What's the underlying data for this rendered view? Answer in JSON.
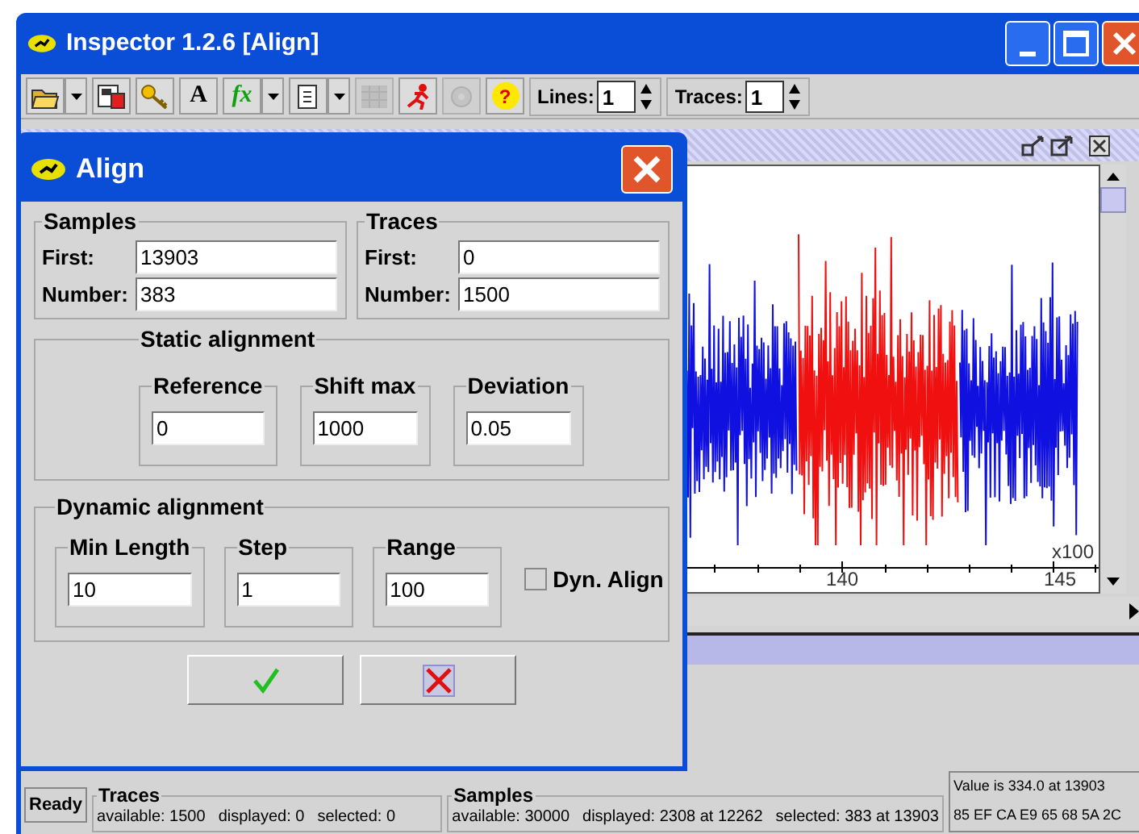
{
  "window": {
    "title": "Inspector 1.2.6 [Align]"
  },
  "toolbar": {
    "buttons": [
      {
        "kind": "open",
        "dropdown": true,
        "disabled": false
      },
      {
        "kind": "save",
        "dropdown": false,
        "disabled": false
      },
      {
        "kind": "key",
        "dropdown": false,
        "disabled": false
      },
      {
        "kind": "text",
        "text": "A",
        "dropdown": false,
        "disabled": false
      },
      {
        "kind": "formula",
        "text": "fx",
        "dropdown": true,
        "disabled": false
      },
      {
        "kind": "page",
        "dropdown": true,
        "disabled": false
      },
      {
        "kind": "grid",
        "dropdown": false,
        "disabled": true
      },
      {
        "kind": "run",
        "dropdown": false,
        "disabled": false
      },
      {
        "kind": "gear",
        "dropdown": false,
        "disabled": true
      },
      {
        "kind": "help",
        "text": "?",
        "dropdown": false,
        "disabled": false
      }
    ],
    "spinners": [
      {
        "label": "Lines:",
        "value": "1"
      },
      {
        "label": "Traces:",
        "value": "1"
      }
    ]
  },
  "plot": {
    "tick_labels": [
      "140",
      "145"
    ],
    "scale_label": "x100"
  },
  "dialog": {
    "title": "Align",
    "samples": {
      "title": "Samples",
      "fields": [
        {
          "label": "First:",
          "value": "13903"
        },
        {
          "label": "Number:",
          "value": "383"
        }
      ]
    },
    "traces": {
      "title": "Traces",
      "fields": [
        {
          "label": "First:",
          "value": "0"
        },
        {
          "label": "Number:",
          "value": "1500"
        }
      ]
    },
    "static_alignment": {
      "title": "Static alignment",
      "fields": [
        {
          "label": "Reference",
          "value": "0"
        },
        {
          "label": "Shift max",
          "value": "1000"
        },
        {
          "label": "Deviation",
          "value": "0.05"
        }
      ]
    },
    "dynamic_alignment": {
      "title": "Dynamic alignment",
      "fields": [
        {
          "label": "Min Length",
          "value": "10"
        },
        {
          "label": "Step",
          "value": "1"
        },
        {
          "label": "Range",
          "value": "100"
        }
      ],
      "checkbox": {
        "label": "Dyn. Align",
        "checked": false
      }
    },
    "buttons": [
      {
        "kind": "ok"
      },
      {
        "kind": "cancel"
      }
    ]
  },
  "status_bar": {
    "state": "Ready",
    "traces": {
      "title": "Traces",
      "items": [
        "available: 1500",
        "displayed: 0",
        "selected: 0"
      ]
    },
    "samples": {
      "title": "Samples",
      "items": [
        "available: 30000",
        "displayed: 2308 at 12262",
        "selected: 383 at 13903"
      ]
    },
    "value": [
      "Value is 334.0 at 13903",
      "85 EF CA E9 65 68 5A 2C"
    ]
  }
}
